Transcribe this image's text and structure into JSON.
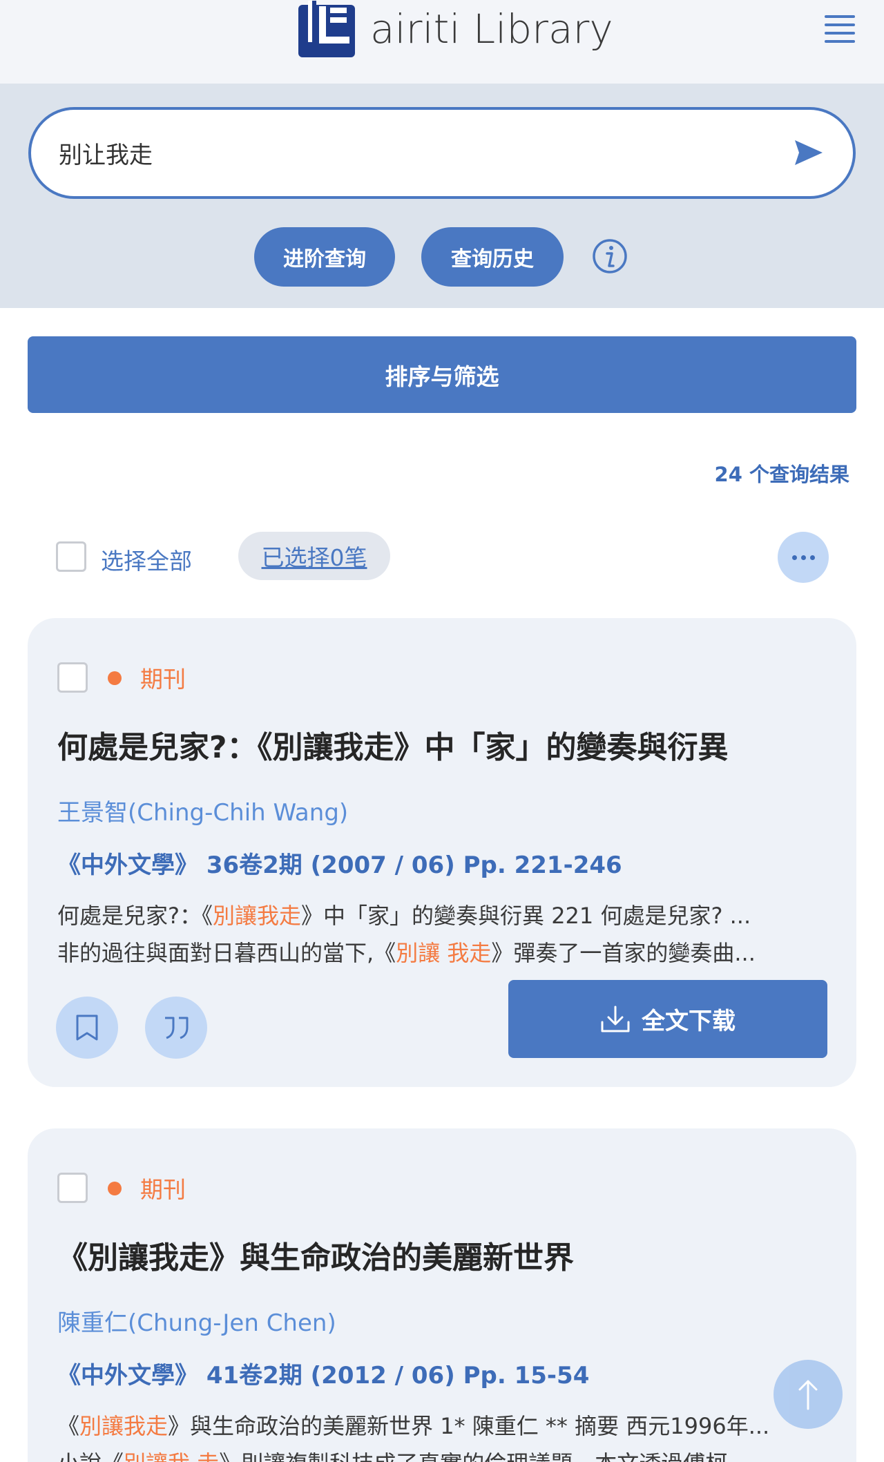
{
  "header": {
    "logo_text": "airiti Library",
    "menu_icon": "hamburger-menu-icon"
  },
  "search": {
    "query": "别让我走",
    "submit_icon": "send-arrow-icon",
    "advanced_label": "进阶查询",
    "history_label": "查询历史",
    "info_icon": "info-icon"
  },
  "sort_filter_label": "排序与筛选",
  "result_count": "24 个查询结果",
  "selection": {
    "select_all_label": "选择全部",
    "selected_label": "已选择0笔",
    "more_icon": "ellipsis-icon"
  },
  "results": [
    {
      "type": "期刊",
      "title": "何處是兒家?：《別讓我走》中「家」的變奏與衍異",
      "author": "王景智(Ching-Chih Wang)",
      "source": "《中外文學》 36卷2期 (2007 / 06) Pp. 221-246",
      "snippet_line1": [
        {
          "text": "何處是兒家?：《",
          "hl": false
        },
        {
          "text": "別讓我走",
          "hl": true
        },
        {
          "text": "》中「家」的變奏與衍異 221 何處是兒家? ...",
          "hl": false
        }
      ],
      "snippet_line2": [
        {
          "text": "非的過往與面對日暮西山的當下,《",
          "hl": false
        },
        {
          "text": "別讓 我走",
          "hl": true
        },
        {
          "text": "》彈奏了一首家的變奏曲...",
          "hl": false
        }
      ],
      "download_label": "全文下载"
    },
    {
      "type": "期刊",
      "title": "《別讓我走》與生命政治的美麗新世界",
      "author": "陳重仁(Chung-Jen Chen)",
      "source": "《中外文學》 41卷2期 (2012 / 06) Pp. 15-54",
      "snippet_line1": [
        {
          "text": "《",
          "hl": false
        },
        {
          "text": "別讓我走",
          "hl": true
        },
        {
          "text": "》與生命政治的美麗新世界 1* 陳重仁 ** 摘要 西元1996年...",
          "hl": false
        }
      ],
      "snippet_line2": [
        {
          "text": "小說《",
          "hl": false
        },
        {
          "text": "別讓我 走",
          "hl": true
        },
        {
          "text": "》則讓複製科技成了真實的倫理議題，本文透過傅柯",
          "hl": false
        }
      ]
    }
  ],
  "colors": {
    "accent": "#4a78c2",
    "highlight": "#f47b42",
    "search_zone_bg": "#dce3ec",
    "card_bg": "#eef2f8"
  }
}
